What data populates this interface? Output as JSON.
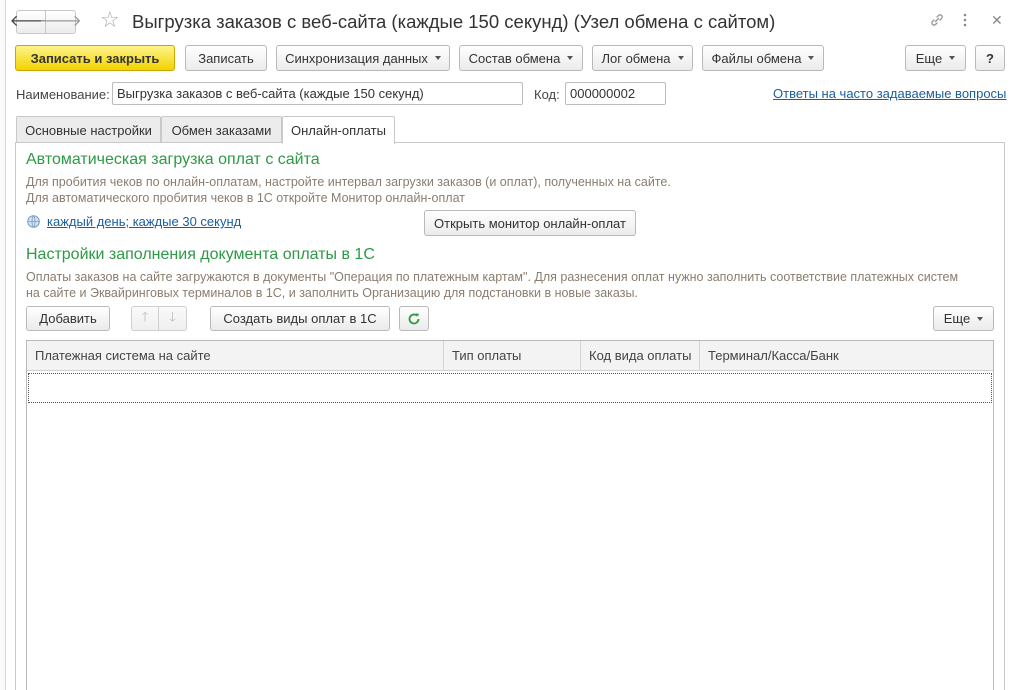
{
  "window": {
    "title": "Выгрузка заказов с веб-сайта (каждые 150 секунд) (Узел обмена с сайтом)",
    "link_icon": "link-icon",
    "more_icon": "vertical-dots-icon",
    "close_icon": "close-icon"
  },
  "toolbar": {
    "save_close": "Записать и закрыть",
    "save": "Записать",
    "sync": "Синхронизация данных",
    "composition": "Состав обмена",
    "log": "Лог обмена",
    "files": "Файлы обмена",
    "more": "Еще",
    "help": "?"
  },
  "form": {
    "name_label": "Наименование:",
    "name_value": "Выгрузка заказов с веб-сайта (каждые 150 секунд)",
    "code_label": "Код:",
    "code_value": "000000002",
    "faq_link": "Ответы на часто задаваемые вопросы"
  },
  "tabs": [
    {
      "label": "Основные настройки",
      "active": false
    },
    {
      "label": "Обмен заказами",
      "active": false
    },
    {
      "label": "Онлайн-оплаты",
      "active": true
    }
  ],
  "auto_load": {
    "heading": "Автоматическая загрузка оплат с сайта",
    "hint_line1": "Для пробития чеков по онлайн-оплатам, настройте интервал загрузки заказов (и оплат), полученных на сайте.",
    "hint_line2": "Для автоматического пробития чеков в 1С откройте Монитор онлайн-оплат",
    "schedule_link": "каждый день; каждые 30 секунд",
    "monitor_button": "Открыть монитор онлайн-оплат"
  },
  "payment_doc": {
    "heading": "Настройки заполнения документа оплаты в 1С",
    "hint_line1": "Оплаты заказов на сайте загружаются в документы \"Операция по платежным картам\". Для разнесения оплат нужно заполнить соответствие платежных систем",
    "hint_line2": "на сайте и Эквайринговых терминалов в 1С, и заполнить Организацию для подстановки в новые заказы.",
    "add_button": "Добавить",
    "create_button": "Создать виды оплат в 1С",
    "more_button": "Еще"
  },
  "table": {
    "columns": [
      "Платежная система на сайте",
      "Тип оплаты",
      "Код вида оплаты",
      "Терминал/Касса/Банк"
    ],
    "rows": []
  }
}
